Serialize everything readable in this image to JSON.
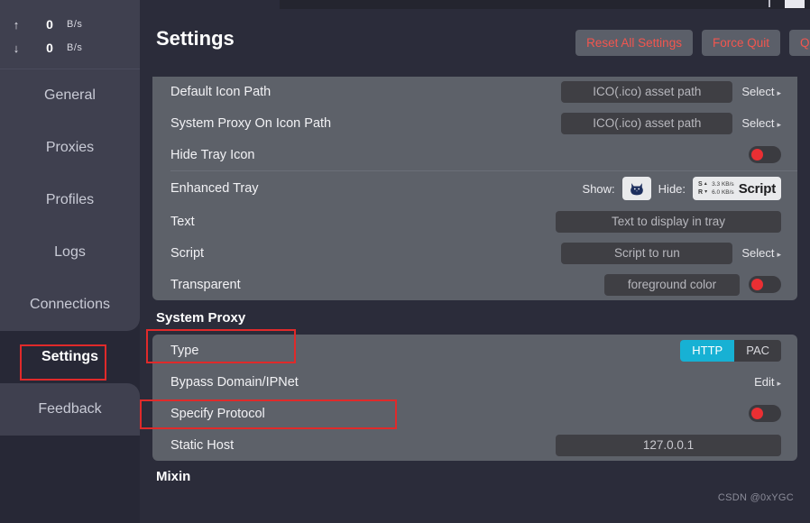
{
  "sidebar": {
    "speed": {
      "upload": {
        "icon": "arrow-up-icon",
        "glyph": "↑",
        "value": "0",
        "unit": "B/s"
      },
      "download": {
        "icon": "arrow-down-icon",
        "glyph": "↓",
        "value": "0",
        "unit": "B/s"
      }
    },
    "items": [
      {
        "label": "General",
        "active": false
      },
      {
        "label": "Proxies",
        "active": false
      },
      {
        "label": "Profiles",
        "active": false
      },
      {
        "label": "Logs",
        "active": false
      },
      {
        "label": "Connections",
        "active": false
      },
      {
        "label": "Settings",
        "active": true
      },
      {
        "label": "Feedback",
        "active": false
      }
    ]
  },
  "header": {
    "title": "Settings",
    "buttons": [
      {
        "label": "Reset All Settings"
      },
      {
        "label": "Force Quit"
      },
      {
        "label": "Qui"
      }
    ]
  },
  "tray_card": {
    "rows": [
      {
        "label": "Default Icon Path",
        "field_placeholder": "ICO(.ico) asset path",
        "select_label": "Select",
        "caret": "▸"
      },
      {
        "label": "System Proxy On Icon Path",
        "field_placeholder": "ICO(.ico) asset path",
        "select_label": "Select",
        "caret": "▸"
      },
      {
        "label": "Hide Tray Icon",
        "toggle": "off"
      }
    ],
    "enhanced": {
      "label": "Enhanced Tray",
      "show_label": "Show:",
      "show_icon": "cat-icon",
      "hide_label": "Hide:",
      "hide_s": "S",
      "hide_r": "R",
      "hide_s_caret": "▴",
      "hide_r_caret": "▾",
      "hide_up_rate": "3.3 KB/s",
      "hide_down_rate": "6.0 KB/s",
      "hide_script": "Script"
    },
    "text_row": {
      "label": "Text",
      "field_placeholder": "Text to display in tray"
    },
    "script_row": {
      "label": "Script",
      "field_placeholder": "Script to run",
      "select_label": "Select",
      "caret": "▸"
    },
    "transparent_row": {
      "label": "Transparent",
      "field_placeholder": "foreground color",
      "toggle": "off"
    }
  },
  "system_proxy": {
    "section_title": "System Proxy",
    "type_row": {
      "label": "Type",
      "options": [
        {
          "label": "HTTP",
          "selected": true
        },
        {
          "label": "PAC",
          "selected": false
        }
      ]
    },
    "bypass_row": {
      "label": "Bypass Domain/IPNet",
      "edit_label": "Edit",
      "caret": "▸"
    },
    "specify_row": {
      "label": "Specify Protocol",
      "toggle": "off"
    },
    "static_host_row": {
      "label": "Static Host",
      "value": "127.0.0.1"
    }
  },
  "mixin": {
    "section_title": "Mixin"
  },
  "watermark": {
    "text": "CSDN @0xYGC"
  },
  "colors": {
    "accent_cyan": "#17b1d4",
    "danger_red": "#f2564f",
    "toggle_knob": "#ea2f33",
    "annotation": "#e02a2a",
    "card_bg": "#5d6169",
    "app_bg": "#2b2c3a",
    "sidebar_bg": "#3f404f"
  }
}
